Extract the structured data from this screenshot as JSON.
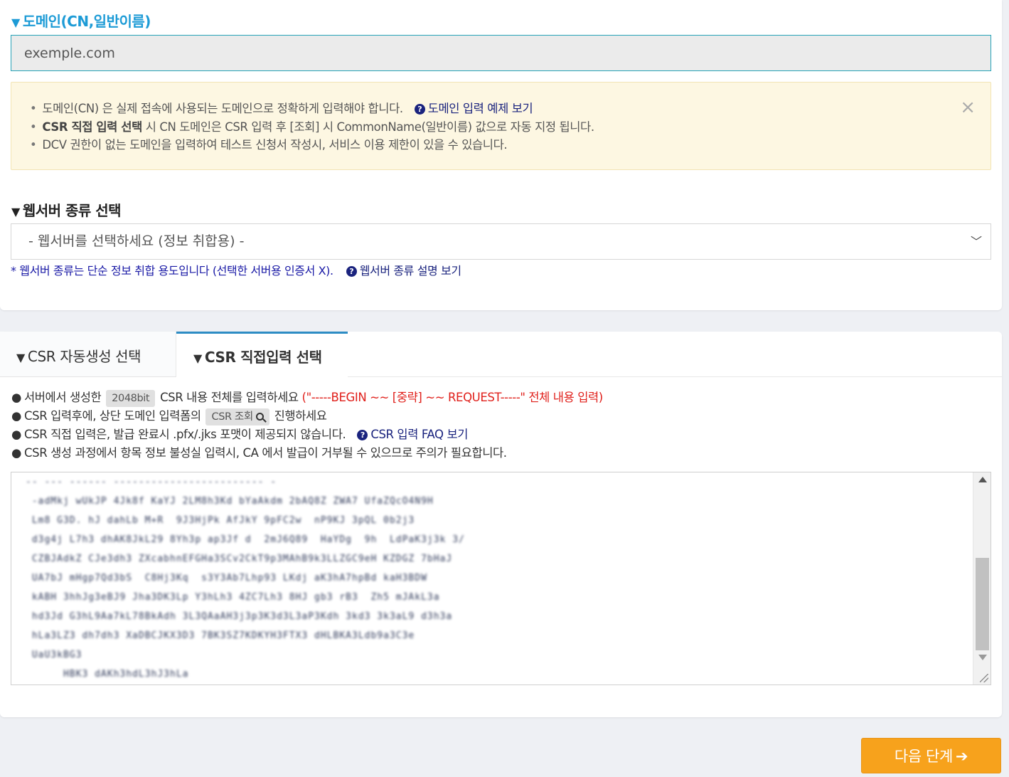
{
  "domain": {
    "title": "도메인(CN,일반이름)",
    "input_value": "exemple.com"
  },
  "notice": {
    "line1": "도메인(CN) 은 실제 접속에 사용되는 도메인으로 정확하게 입력해야 합니다.",
    "line1_link": "도메인 입력 예제 보기",
    "line2_bold": "CSR 직접 입력 선택",
    "line2_rest": " 시 CN 도메인은 CSR 입력 후 [조회] 시 CommonName(일반이름) 값으로 자동 지정 됩니다.",
    "line3": "DCV 권한이 없는 도메인을 입력하여 테스트 신청서 작성시, 서비스 이용 제한이 있을 수 있습니다.",
    "close": "×"
  },
  "webserver": {
    "title": "웹서버 종류 선택",
    "selected": "- 웹서버를 선택하세요 (정보 취합용) -",
    "note": "* 웹서버 종류는 단순 정보 취합 용도입니다 (선택한 서버용 인증서 X).",
    "note_link": "웹서버 종류 설명 보기"
  },
  "tabs": [
    {
      "label": "CSR 자동생성 선택",
      "active": false
    },
    {
      "label": "CSR 직접입력 선택",
      "active": true
    }
  ],
  "guide": {
    "l1_a": "서버에서 생성한",
    "l1_chip": "2048bit",
    "l1_b": "CSR 내용 전체를 입력하세요",
    "l1_red": "(\"-----BEGIN ~~ [중략] ~~ REQUEST-----\" 전체 내용 입력)",
    "l2_a": "CSR 입력후에, 상단 도메인 입력폼의",
    "l2_chip": "CSR 조회",
    "l2_b": "진행하세요",
    "l3": "CSR 직접 입력은, 발급 완료시 .pfx/.jks 포맷이 제공되지 않습니다.",
    "l3_link": "CSR 입력 FAQ 보기",
    "l4": "CSR 생성 과정에서 항목 정보 불성실 입력시, CA 에서 발급이 거부될 수 있으므로 주의가 필요합니다."
  },
  "next_button": "다음 단계",
  "colors": {
    "accent_blue": "#1d9bd6",
    "tab_active": "#2d8cc4",
    "button_orange": "#f7a21c",
    "warning_red": "#e0201b"
  }
}
